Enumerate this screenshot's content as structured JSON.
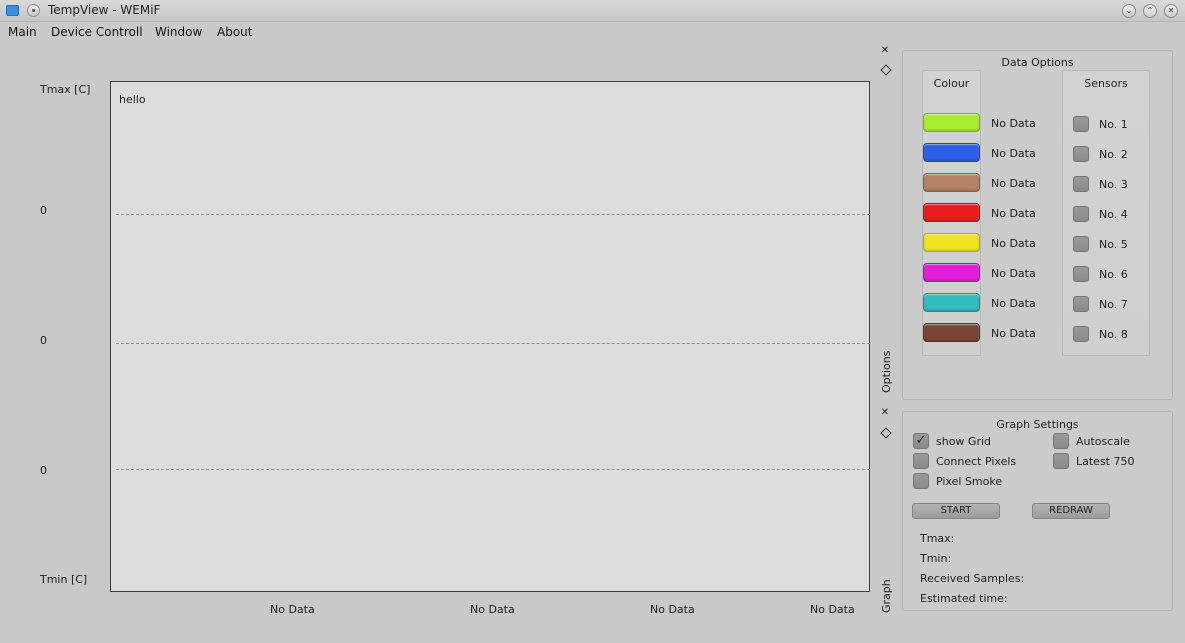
{
  "window": {
    "title": "TempView - WEMiF"
  },
  "menu": [
    "Main",
    "Device Controll",
    "Window",
    "About"
  ],
  "graph": {
    "text": "hello",
    "y_labels": {
      "top": "Tmax [C]",
      "bottom": "Tmin [C]",
      "mid": [
        "0",
        "0",
        "0"
      ]
    },
    "x_labels": [
      "No Data",
      "No Data",
      "No Data",
      "No Data"
    ]
  },
  "options_dock": {
    "dock_title": "Options",
    "panel_title": "Data Options",
    "colour_header": "Colour",
    "sensors_header": "Sensors",
    "rows": [
      {
        "color": "#a9ee2c",
        "status": "No Data",
        "sensor": "No. 1"
      },
      {
        "color": "#2e5fe6",
        "status": "No Data",
        "sensor": "No. 2"
      },
      {
        "color": "#b48266",
        "status": "No Data",
        "sensor": "No. 3"
      },
      {
        "color": "#e81c1c",
        "status": "No Data",
        "sensor": "No. 4"
      },
      {
        "color": "#ece520",
        "status": "No Data",
        "sensor": "No. 5"
      },
      {
        "color": "#e21ed9",
        "status": "No Data",
        "sensor": "No. 6"
      },
      {
        "color": "#35bcc0",
        "status": "No Data",
        "sensor": "No. 7"
      },
      {
        "color": "#7a4538",
        "status": "No Data",
        "sensor": "No. 8"
      }
    ]
  },
  "graph_dock": {
    "dock_title": "Graph",
    "panel_title": "Graph Settings",
    "show_grid": {
      "label": "show Grid",
      "checked": true
    },
    "autoscale": {
      "label": "Autoscale",
      "checked": false
    },
    "connect_pixels": {
      "label": "Connect Pixels",
      "checked": false
    },
    "latest": {
      "label": "Latest 750",
      "checked": false
    },
    "pixel_smoke": {
      "label": "Pixel Smoke",
      "checked": false
    },
    "start_label": "START",
    "redraw_label": "REDRAW",
    "tmax_label": "Tmax:",
    "tmin_label": "Tmin:",
    "received_label": "Received Samples:",
    "estimated_label": "Estimated time:"
  }
}
